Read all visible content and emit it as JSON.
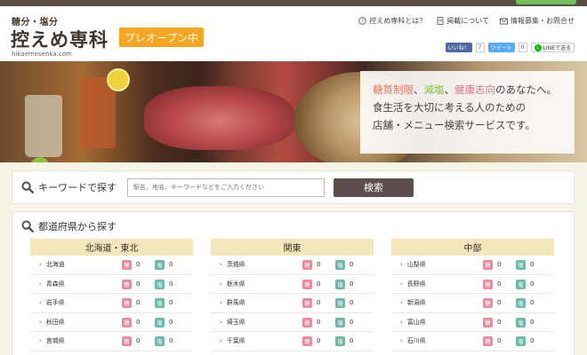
{
  "header": {
    "logo_sub": "糖分・塩分",
    "logo_main": "控えめ専科",
    "logo_url": "hikaemesenka.com",
    "preopen_label": "プレオープン中",
    "nav": [
      {
        "icon": "question-circle-icon",
        "label": "控えめ専科とは？"
      },
      {
        "icon": "document-icon",
        "label": "掲載について"
      },
      {
        "icon": "mail-icon",
        "label": "情報募集・お問合せ"
      }
    ],
    "social": {
      "like_label": "いいね！",
      "like_count": "7",
      "tweet_label": "ツイート",
      "tweet_count": "0",
      "line_label": "LINEで送る"
    }
  },
  "hero": {
    "keyword1": "糖質制限",
    "sep1": "、",
    "keyword2": "減塩",
    "sep2": "、",
    "keyword3": "健康志向",
    "line1_rest": "のあなたへ。",
    "line2": "食生活を大切に考える人のための",
    "line3": "店舗・メニュー検索サービスです。"
  },
  "search": {
    "title": "キーワードで探す",
    "placeholder": "駅名、地名、キーワードなどをご入力ください",
    "button": "検索"
  },
  "prefecture": {
    "title": "都道府県から探す",
    "badge_sugar": "糖",
    "badge_salt": "塩",
    "regions": [
      {
        "name": "北海道・東北",
        "items": [
          {
            "name": "北海道",
            "sugar": "0",
            "salt": "0"
          },
          {
            "name": "青森県",
            "sugar": "0",
            "salt": "0"
          },
          {
            "name": "岩手県",
            "sugar": "0",
            "salt": "0"
          },
          {
            "name": "秋田県",
            "sugar": "0",
            "salt": "0"
          },
          {
            "name": "宮城県",
            "sugar": "0",
            "salt": "0"
          }
        ]
      },
      {
        "name": "関東",
        "items": [
          {
            "name": "茨城県",
            "sugar": "0",
            "salt": "0"
          },
          {
            "name": "栃木県",
            "sugar": "0",
            "salt": "0"
          },
          {
            "name": "群馬県",
            "sugar": "0",
            "salt": "0"
          },
          {
            "name": "埼玉県",
            "sugar": "0",
            "salt": "0"
          },
          {
            "name": "千葉県",
            "sugar": "0",
            "salt": "0"
          }
        ]
      },
      {
        "name": "中部",
        "items": [
          {
            "name": "山梨県",
            "sugar": "0",
            "salt": "0"
          },
          {
            "name": "長野県",
            "sugar": "0",
            "salt": "0"
          },
          {
            "name": "新潟県",
            "sugar": "0",
            "salt": "0"
          },
          {
            "name": "富山県",
            "sugar": "0",
            "salt": "0"
          },
          {
            "name": "石川県",
            "sugar": "0",
            "salt": "0"
          }
        ]
      }
    ]
  }
}
